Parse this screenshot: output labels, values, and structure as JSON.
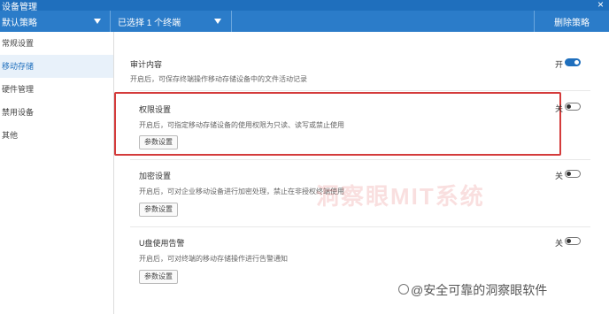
{
  "window": {
    "title": "设备管理",
    "close_glyph": "×"
  },
  "toolbar": {
    "policy_select": "默认策略",
    "terminal_select": "已选择 1 个终端",
    "delete_label": "删除策略"
  },
  "sidebar": {
    "items": [
      {
        "label": "常规设置"
      },
      {
        "label": "移动存储"
      },
      {
        "label": "硬件管理"
      },
      {
        "label": "禁用设备"
      },
      {
        "label": "其他"
      }
    ]
  },
  "sections": [
    {
      "title": "审计内容",
      "desc": "开启后，可保存终端操作移动存储设备中的文件活动记录",
      "toggle_label": "开",
      "state": "on",
      "button": ""
    },
    {
      "title": "权限设置",
      "desc": "开启后，可指定移动存储设备的使用权限为只读、读写或禁止使用",
      "toggle_label": "关",
      "state": "off",
      "button": "参数设置"
    },
    {
      "title": "加密设置",
      "desc": "开启后，可对企业移动设备进行加密处理，禁止在非授权终端使用",
      "toggle_label": "关",
      "state": "off",
      "button": "参数设置"
    },
    {
      "title": "U盘使用告警",
      "desc": "开启后，可对终端的移动存储操作进行告警通知",
      "toggle_label": "关",
      "state": "off",
      "button": "参数设置"
    }
  ],
  "watermarks": {
    "middle": "洞察眼MIT系统",
    "corner": "@安全可靠的洞察眼软件"
  },
  "colors": {
    "accent": "#2b7cc9",
    "highlight": "#d43b3b"
  }
}
